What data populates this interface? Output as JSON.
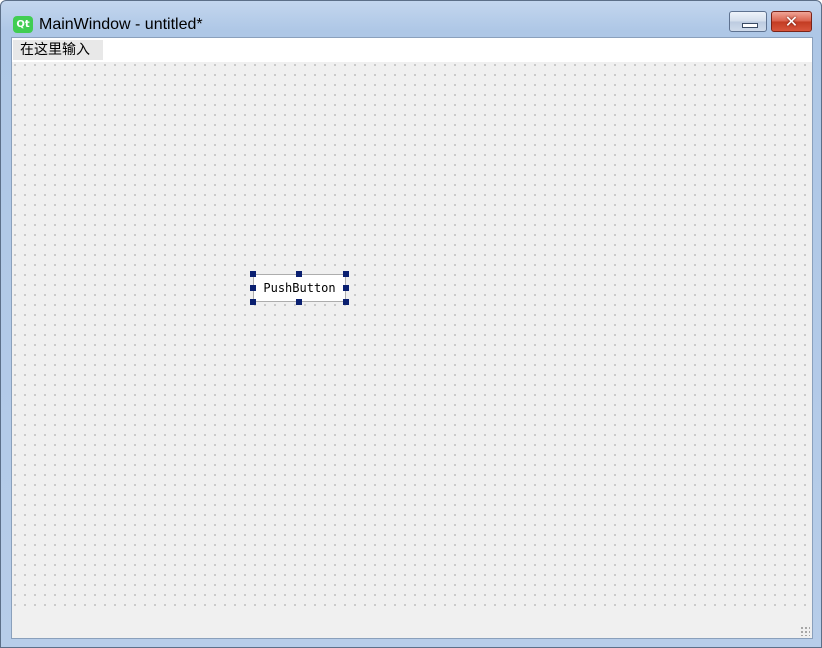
{
  "window": {
    "title": "MainWindow - untitled*",
    "app_icon": "qt-logo-icon",
    "app_icon_text": "Qt",
    "controls": {
      "minimize": "minimize-icon",
      "close": "close-icon"
    }
  },
  "menubar": {
    "items": [
      {
        "label": "在这里输入"
      }
    ]
  },
  "form": {
    "widgets": [
      {
        "type": "QPushButton",
        "label": "PushButton",
        "selected": true
      }
    ]
  },
  "colors": {
    "qt_green": "#41cd52",
    "close_red": "#c23b22",
    "selection_handle": "#0a1f70"
  }
}
